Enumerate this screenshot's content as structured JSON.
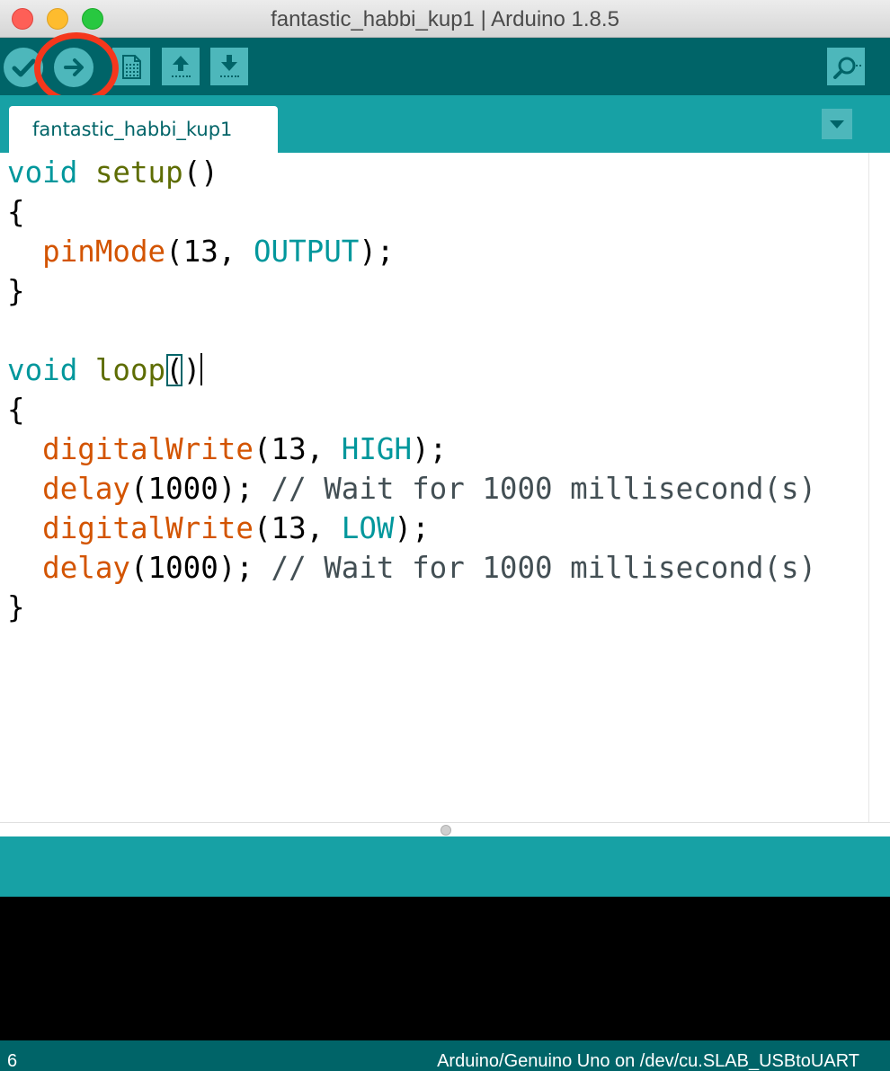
{
  "window": {
    "title": "fantastic_habbi_kup1 | Arduino 1.8.5"
  },
  "toolbar": {
    "verify_icon": "check-icon",
    "upload_icon": "arrow-right-icon",
    "new_icon": "new-document-icon",
    "open_icon": "arrow-up-icon",
    "save_icon": "arrow-down-icon",
    "serial_monitor_icon": "magnifier-icon",
    "highlight_color": "#f5371c"
  },
  "tabs": [
    {
      "label": "fantastic_habbi_kup1",
      "active": true
    }
  ],
  "editor": {
    "lines": [
      [
        {
          "t": "void",
          "c": "kw"
        },
        {
          "t": " "
        },
        {
          "t": "setup",
          "c": "fn"
        },
        {
          "t": "()"
        }
      ],
      [
        {
          "t": "{"
        }
      ],
      [
        {
          "t": "  "
        },
        {
          "t": "pinMode",
          "c": "ard"
        },
        {
          "t": "(13, "
        },
        {
          "t": "OUTPUT",
          "c": "cst"
        },
        {
          "t": ");"
        }
      ],
      [
        {
          "t": "}"
        }
      ],
      [
        {
          "t": ""
        }
      ],
      [
        {
          "t": "void",
          "c": "kw"
        },
        {
          "t": " "
        },
        {
          "t": "loop",
          "c": "fn"
        },
        {
          "t": "(",
          "c": "bracket-hl"
        },
        {
          "t": ")"
        },
        {
          "caret": true
        }
      ],
      [
        {
          "t": "{"
        }
      ],
      [
        {
          "t": "  "
        },
        {
          "t": "digitalWrite",
          "c": "ard"
        },
        {
          "t": "(13, "
        },
        {
          "t": "HIGH",
          "c": "cst"
        },
        {
          "t": ");"
        }
      ],
      [
        {
          "t": "  "
        },
        {
          "t": "delay",
          "c": "ard"
        },
        {
          "t": "(1000); "
        },
        {
          "t": "// Wait for 1000 millisecond(s)",
          "c": "cmt"
        }
      ],
      [
        {
          "t": "  "
        },
        {
          "t": "digitalWrite",
          "c": "ard"
        },
        {
          "t": "(13, "
        },
        {
          "t": "LOW",
          "c": "cst"
        },
        {
          "t": ");"
        }
      ],
      [
        {
          "t": "  "
        },
        {
          "t": "delay",
          "c": "ard"
        },
        {
          "t": "(1000); "
        },
        {
          "t": "// Wait for 1000 millisecond(s)",
          "c": "cmt"
        }
      ],
      [
        {
          "t": "}"
        }
      ]
    ]
  },
  "status": {
    "line_number": "6",
    "board": "Arduino/Genuino Uno on /dev/cu.SLAB_USBtoUART"
  },
  "colors": {
    "toolbar_bg": "#006468",
    "tabbar_bg": "#17a1a5",
    "button_bg": "#4db7bb",
    "console_bg": "#000000"
  }
}
